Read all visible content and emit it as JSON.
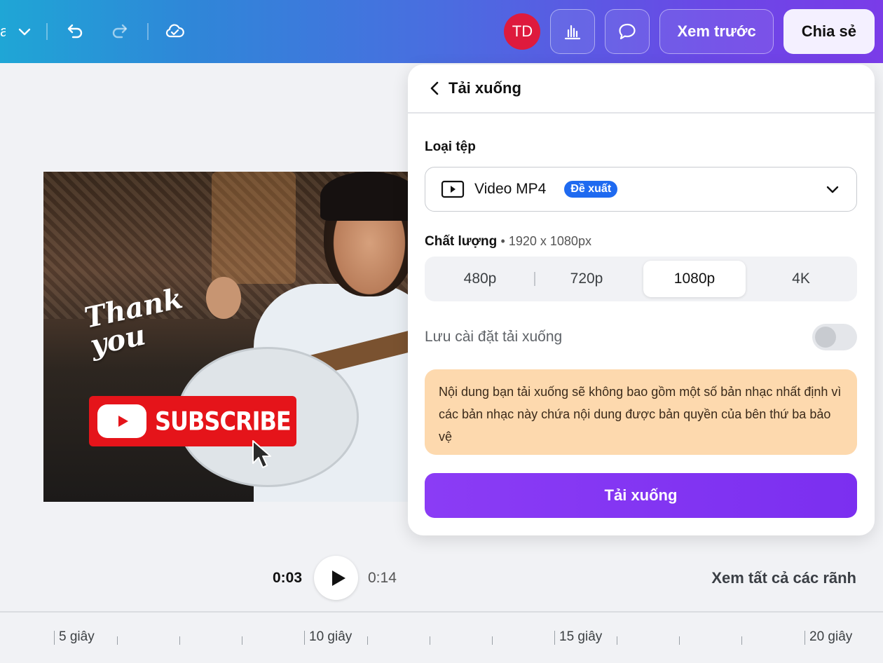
{
  "topbar": {
    "left_fragment": "a",
    "avatar_initials": "TD",
    "preview_label": "Xem trước",
    "share_label": "Chia sẻ"
  },
  "canvas": {
    "thank_text": "Thank you",
    "subscribe_text": "SUBSCRIBE"
  },
  "playback": {
    "current_time": "0:03",
    "total_time": "0:14",
    "view_all_tracks": "Xem tất cả các rãnh"
  },
  "timeline": {
    "labels": [
      "5 giây",
      "10 giây",
      "15 giây",
      "20 giây"
    ]
  },
  "download_panel": {
    "title": "Tải xuống",
    "file_type_label": "Loại tệp",
    "file_type_value": "Video MP4",
    "file_type_badge": "Đề xuất",
    "quality_label": "Chất lượng",
    "quality_resolution": "• 1920 x 1080px",
    "quality_options": [
      "480p",
      "720p",
      "1080p",
      "4K"
    ],
    "quality_selected": "1080p",
    "save_settings_label": "Lưu cài đặt tải xuống",
    "save_settings_enabled": false,
    "notice": "Nội dung bạn tải xuống sẽ không bao gồm một số bản nhạc nhất định vì các bản nhạc này chứa nội dung được bản quyền của bên thứ ba bảo vệ",
    "download_button": "Tải xuống"
  },
  "colors": {
    "accent_purple": "#7b2ff0",
    "badge_blue": "#1f6af0",
    "avatar_red": "#de1a3d",
    "notice_bg": "#fdd9ae",
    "subscribe_red": "#e5141a"
  }
}
